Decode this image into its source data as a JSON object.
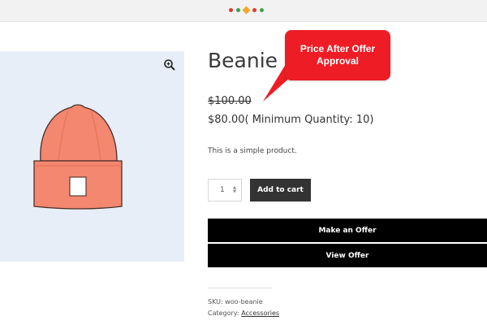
{
  "product": {
    "title": "Beanie",
    "old_price": "$100.00",
    "new_price": "$80.00( Minimum Quantity: 10)",
    "description": "This is a simple product.",
    "quantity": "1",
    "sku_label": "SKU:",
    "sku_value": "woo-beanie",
    "category_label": "Category:",
    "category_value": "Accessories"
  },
  "buttons": {
    "add_to_cart": "Add to cart",
    "make_offer": "Make an Offer",
    "view_offer": "View Offer"
  },
  "callout": {
    "line1": "Price After Offer",
    "line2": "Approval"
  },
  "icons": {
    "zoom": "magnifier-plus-icon",
    "product_image": "beanie-hat-image"
  },
  "colors": {
    "callout_bg": "#ee1c25",
    "add_button_bg": "#333333",
    "bar_button_bg": "#000000",
    "gallery_bg": "#e8eef7",
    "hat_color": "#f4876f"
  }
}
